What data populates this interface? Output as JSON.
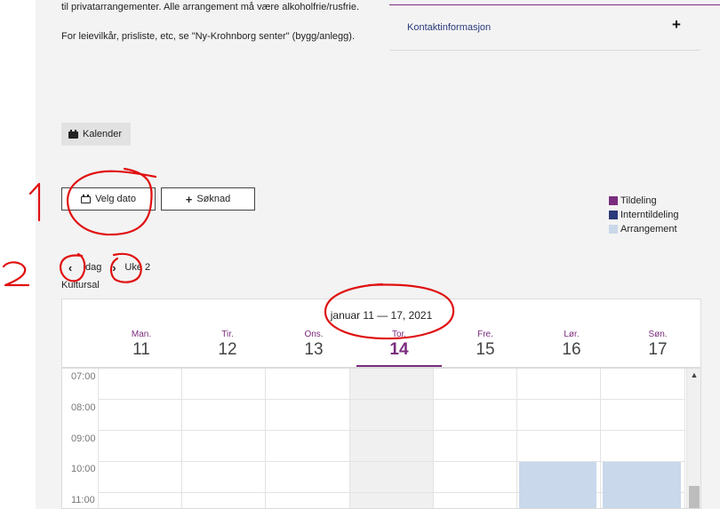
{
  "intro": {
    "line1": "til privatarrangementer. Alle arrangement må være alkoholfrie/rusfrie.",
    "line2": "For leievilkår, prisliste, etc, se \"Ny-Krohnborg senter\" (bygg/anlegg)."
  },
  "contact": {
    "label": "Kontaktinformasjon",
    "toggle": "+"
  },
  "calendar_tab": {
    "label": "Kalender",
    "icon": "calendar-icon"
  },
  "actions": {
    "pick_date": {
      "label": "Velg dato",
      "icon": "calendar-icon"
    },
    "application": {
      "label": "Søknad",
      "icon": "plus-icon"
    }
  },
  "legend": [
    {
      "label": "Tildeling",
      "color": "#7a2c7e"
    },
    {
      "label": "Interntildeling",
      "color": "#2a3a7a"
    },
    {
      "label": "Arrangement",
      "color": "#c9d8ea"
    }
  ],
  "nav": {
    "prev": "‹",
    "today": "Idag",
    "next": "›",
    "week": "Uke 2"
  },
  "room": "Kultursal",
  "week": {
    "range": "januar 11 — 17, 2021",
    "days": [
      {
        "name": "Man.",
        "num": "11"
      },
      {
        "name": "Tir.",
        "num": "12"
      },
      {
        "name": "Ons.",
        "num": "13"
      },
      {
        "name": "Tor.",
        "num": "14",
        "today": true
      },
      {
        "name": "Fre.",
        "num": "15"
      },
      {
        "name": "Lør.",
        "num": "16"
      },
      {
        "name": "Søn.",
        "num": "17"
      }
    ],
    "times": [
      "07:00",
      "08:00",
      "09:00",
      "10:00",
      "11:00"
    ]
  },
  "annotations": {
    "label1": "1",
    "label2": "2"
  },
  "colors": {
    "accent": "#7a2c7e",
    "event": "#c9d8ea"
  }
}
